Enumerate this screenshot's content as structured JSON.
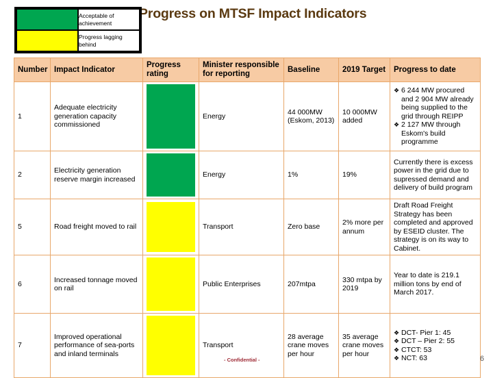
{
  "title": "Progress on MTSF Impact Indicators",
  "legend": [
    {
      "color": "#00A650",
      "label": "Acceptable of achievement"
    },
    {
      "color": "#FFFF00",
      "label": "Progress lagging behind"
    }
  ],
  "table": {
    "headers": [
      "Number",
      "Impact Indicator",
      "Progress rating",
      "Minister responsible for reporting",
      "Baseline",
      "2019 Target",
      "Progress to date"
    ],
    "rows": [
      {
        "number": "1",
        "indicator": "Adequate electricity generation capacity commissioned",
        "rating": "green",
        "minister": "Energy",
        "baseline": "44 000MW (Eskom, 2013)",
        "target": "10 000MW added",
        "progress_bullets": [
          "6 244 MW procured and 2 904 MW already being supplied to the grid through REIPP",
          "2 127 MW through Eskom's build programme"
        ],
        "progress_text": ""
      },
      {
        "number": "2",
        "indicator": "Electricity generation reserve margin increased",
        "rating": "green",
        "minister": "Energy",
        "baseline": "1%",
        "target": "19%",
        "progress_bullets": [],
        "progress_text": "Currently there is excess power in the grid due to supressed demand and delivery of build program"
      },
      {
        "number": "5",
        "indicator": "Road freight moved to rail",
        "rating": "yellow",
        "minister": "Transport",
        "baseline": "Zero base",
        "target": "2% more per annum",
        "progress_bullets": [],
        "progress_text": "Draft Road Freight Strategy has been completed and approved by ESEID cluster. The strategy is on its way  to Cabinet."
      },
      {
        "number": "6",
        "indicator": "Increased tonnage moved on rail",
        "rating": "yellow",
        "minister": "Public Enterprises",
        "baseline": "207mtpa",
        "target": "330 mtpa by 2019",
        "progress_bullets": [],
        "progress_text": "Year to date is 219.1 million tons by end of March 2017."
      },
      {
        "number": "7",
        "indicator": "Improved operational performance of sea-ports and inland terminals",
        "rating": "yellow",
        "minister": "Transport",
        "baseline": "28 average crane moves per hour",
        "target": "35 average crane moves per hour",
        "progress_bullets": [
          "DCT- Pier 1: 45",
          "DCT – Pier 2: 55",
          "CTCT: 53",
          "NCT: 63"
        ],
        "progress_text": ""
      }
    ]
  },
  "footer": {
    "confidential": "- Confidential -",
    "page_number": "6"
  }
}
